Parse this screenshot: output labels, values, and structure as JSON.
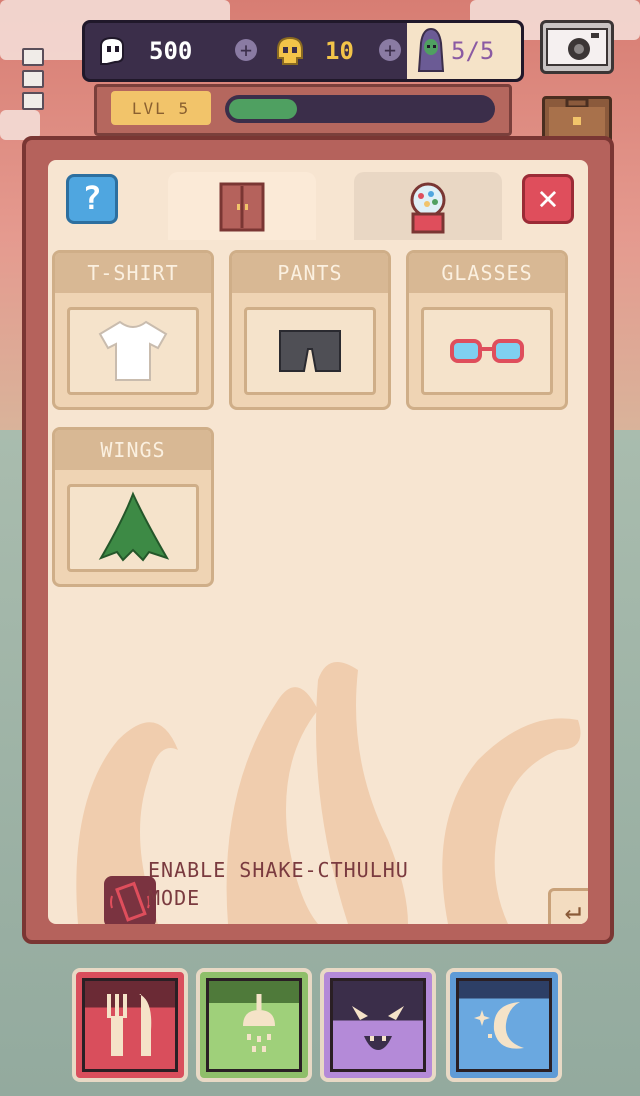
{
  "hud": {
    "ghost_currency": "500",
    "skull_currency": "10",
    "creature_count": "5/5",
    "plus_symbol": "+"
  },
  "level": {
    "label": "LVL 5",
    "progress": 0.26
  },
  "panel": {
    "help_label": "?",
    "close_label": "✕",
    "tabs": [
      "wardrobe-icon",
      "gumball-machine-icon"
    ],
    "categories": [
      {
        "title": "T-SHIRT",
        "icon": "tshirt-icon"
      },
      {
        "title": "PANTS",
        "icon": "pants-icon"
      },
      {
        "title": "GLASSES",
        "icon": "glasses-icon"
      },
      {
        "title": "WINGS",
        "icon": "wings-icon"
      }
    ],
    "shake_mode": "ENABLE SHAKE-CTHULHU MODE",
    "back_label": "↵"
  },
  "actions": [
    "food-icon",
    "shower-icon",
    "cthulhu-face-icon",
    "moon-icon"
  ],
  "colors": {
    "panel_red": "#b5625c",
    "panel_cream": "#f7e5d1",
    "xp_green": "#4fa061",
    "level_yellow": "#f2c46a"
  }
}
